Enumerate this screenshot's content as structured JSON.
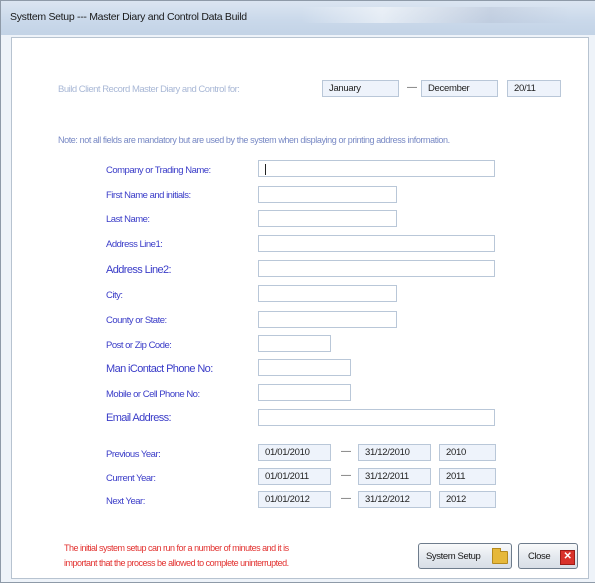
{
  "window": {
    "title": "Systtem Setup --- Master Diary and Control Data Build"
  },
  "build": {
    "label": "Build Client Record Master Diary and Control for:",
    "from_month": "January",
    "to_month": "December",
    "period": "20/11",
    "separator": "—"
  },
  "note": "Note: not all fields are mandatory but are used by the system when displaying or printing address information.",
  "fields": {
    "company": {
      "label": "Company or Trading Name:",
      "value": ""
    },
    "first_name": {
      "label": "First Name and initials:",
      "value": ""
    },
    "last_name": {
      "label": "Last Name:",
      "value": ""
    },
    "address1": {
      "label": "Address Line1:",
      "value": ""
    },
    "address2": {
      "label": "Address Line2:",
      "value": ""
    },
    "city": {
      "label": "City:",
      "value": ""
    },
    "county": {
      "label": "County or State:",
      "value": ""
    },
    "postcode": {
      "label": "Post or Zip Code:",
      "value": ""
    },
    "main_phone": {
      "label": "Man iContact Phone No:",
      "value": ""
    },
    "mobile": {
      "label": "Mobile or Cell Phone No:",
      "value": ""
    },
    "email": {
      "label": "Email Address:",
      "value": ""
    }
  },
  "years": {
    "previous": {
      "label": "Previous Year:",
      "start": "01/01/2010",
      "end": "31/12/2010",
      "year": "2010"
    },
    "current": {
      "label": "Current Year:",
      "start": "01/01/2011",
      "end": "31/12/2011",
      "year": "2011"
    },
    "next": {
      "label": "Next Year:",
      "start": "01/01/2012",
      "end": "31/12/2012",
      "year": "2012"
    },
    "separator": "—"
  },
  "warning": {
    "line1": "The initial system setup can run for a number of minutes and it is",
    "line2": "important that the process be allowed to complete uninterrupted."
  },
  "buttons": {
    "setup": "System Setup",
    "close": "Close"
  },
  "icons": {
    "setup": "folder-icon",
    "close": "close-icon"
  },
  "colors": {
    "label": "#3a3cc8",
    "warning": "#e2312f",
    "close_icon": "#d9322b"
  }
}
